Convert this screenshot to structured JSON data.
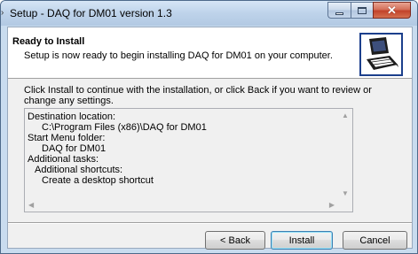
{
  "window": {
    "title": "Setup - DAQ for DM01 version 1.3",
    "app_icon": "setup-app-icon",
    "caption_icons": [
      "minimize-icon",
      "maximize-icon",
      "close-icon"
    ]
  },
  "header": {
    "title": "Ready to Install",
    "subtitle": "Setup is now ready to begin installing DAQ for DM01 on your computer.",
    "image": "computer-wizard-icon"
  },
  "instructions": "Click Install to continue with the installation, or click Back if you want to review or change any settings.",
  "summary": {
    "destination_label": "Destination location:",
    "destination_value": "C:\\Program Files (x86)\\DAQ for DM01",
    "start_menu_label": "Start Menu folder:",
    "start_menu_value": "DAQ for DM01",
    "tasks_label": "Additional tasks:",
    "shortcuts_label": "Additional shortcuts:",
    "shortcut_value": "Create a desktop shortcut"
  },
  "buttons": {
    "back": "< Back",
    "install": "Install",
    "cancel": "Cancel"
  },
  "colors": {
    "title_bar": "#bed3ea",
    "close_button": "#c2422a",
    "dialog_background": "#f0f0f0",
    "header_background": "#ffffff",
    "default_button_border": "#3c7fb1"
  }
}
